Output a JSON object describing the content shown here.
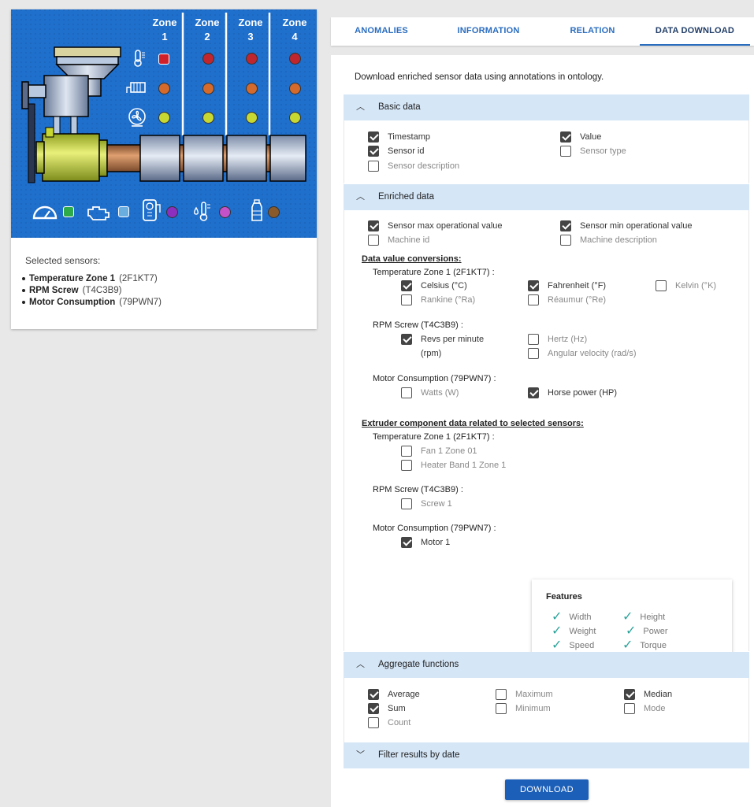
{
  "machine": {
    "zones": [
      {
        "label": "Zone",
        "num": "1"
      },
      {
        "label": "Zone",
        "num": "2"
      },
      {
        "label": "Zone",
        "num": "3"
      },
      {
        "label": "Zone",
        "num": "4"
      }
    ],
    "colors": {
      "background": "#1f6fcc",
      "temp_selected": "#d32f2f",
      "temp": "#c0262d",
      "heater": "#d46a2b",
      "fan": "#c8d832",
      "speed": "#2eaa4a",
      "engine": "#6aaee0",
      "consumption": "#8c2fbf",
      "humidity": "#c552c8",
      "level": "#8b5a2b"
    },
    "icons": [
      "thermometer-icon",
      "heater-band-icon",
      "fan-icon",
      "speedometer-icon",
      "engine-icon",
      "power-meter-icon",
      "humidity-icon",
      "bottle-icon"
    ]
  },
  "selected": {
    "title": "Selected sensors:",
    "items": [
      {
        "name": "Temperature Zone 1",
        "code": "(2F1KT7)"
      },
      {
        "name": "RPM Screw",
        "code": "(T4C3B9)"
      },
      {
        "name": "Motor Consumption",
        "code": "(79PWN7)"
      }
    ]
  },
  "tabs": [
    {
      "label": "ANOMALIES",
      "active": false
    },
    {
      "label": "INFORMATION",
      "active": false
    },
    {
      "label": "RELATION",
      "active": false
    },
    {
      "label": "DATA DOWNLOAD",
      "active": true
    }
  ],
  "intro": "Download enriched sensor data using annotations in ontology.",
  "basic": {
    "title": "Basic data",
    "items": [
      {
        "label": "Timestamp",
        "checked": true
      },
      {
        "label": "Value",
        "checked": true
      },
      {
        "label": "Sensor id",
        "checked": true
      },
      {
        "label": "Sensor type",
        "checked": false
      },
      {
        "label": "Sensor description",
        "checked": false
      }
    ]
  },
  "enriched": {
    "title": "Enriched data",
    "items": [
      {
        "label": "Sensor max operational value",
        "checked": true
      },
      {
        "label": "Sensor min operational value",
        "checked": true
      },
      {
        "label": "Machine id",
        "checked": false
      },
      {
        "label": "Machine description",
        "checked": false
      }
    ],
    "conversions_title": "Data value conversions:",
    "temp_title": "Temperature Zone 1 (2F1KT7) :",
    "temp": [
      {
        "label": "Celsius (°C)",
        "checked": true
      },
      {
        "label": "Fahrenheit (°F)",
        "checked": true
      },
      {
        "label": "Kelvin (°K)",
        "checked": false
      },
      {
        "label": "Rankine (°Ra)",
        "checked": false
      },
      {
        "label": "Réaumur (°Re)",
        "checked": false
      }
    ],
    "rpm_title": "RPM Screw (T4C3B9) :",
    "rpm": [
      {
        "label": "Revs per minute",
        "label2": "(rpm)",
        "checked": true
      },
      {
        "label": "Hertz (Hz)",
        "checked": false
      },
      {
        "label": "Angular velocity (rad/s)",
        "checked": false
      }
    ],
    "motor_title": "Motor Consumption (79PWN7) :",
    "motor": [
      {
        "label": "Watts (W)",
        "checked": false
      },
      {
        "label": "Horse power (HP)",
        "checked": true
      }
    ],
    "extruder_title": "Extruder component data related to selected sensors:",
    "ext_temp_title": "Temperature Zone 1 (2F1KT7) :",
    "ext_temp": [
      {
        "label": "Fan 1 Zone 01",
        "checked": false
      },
      {
        "label": "Heater Band 1 Zone 1",
        "checked": false
      }
    ],
    "ext_rpm_title": "RPM Screw (T4C3B9) :",
    "ext_rpm": [
      {
        "label": "Screw 1",
        "checked": false
      }
    ],
    "ext_motor_title": "Motor Consumption (79PWN7) :",
    "ext_motor": [
      {
        "label": "Motor 1",
        "checked": true
      }
    ],
    "features_title": "Features",
    "features": [
      "Width",
      "Height",
      "Weight",
      "Power",
      "Speed",
      "Torque"
    ]
  },
  "aggregate": {
    "title": "Aggregate functions",
    "items": [
      {
        "label": "Average",
        "checked": true
      },
      {
        "label": "Maximum",
        "checked": false
      },
      {
        "label": "Median",
        "checked": true
      },
      {
        "label": "Sum",
        "checked": true
      },
      {
        "label": "Minimum",
        "checked": false
      },
      {
        "label": "Mode",
        "checked": false
      },
      {
        "label": "Count",
        "checked": false
      }
    ]
  },
  "filter": {
    "title": "Filter results by date"
  },
  "download_label": "DOWNLOAD"
}
